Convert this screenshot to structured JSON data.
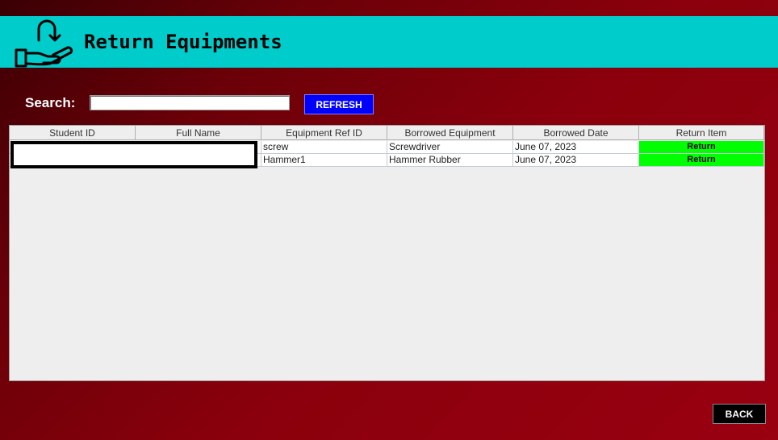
{
  "header": {
    "title": "Return Equipments",
    "icon": "hand-return-icon",
    "background": "#00cccc"
  },
  "search": {
    "label": "Search:",
    "value": "",
    "placeholder": ""
  },
  "buttons": {
    "refresh": "REFRESH",
    "back": "BACK",
    "refresh_color": "#0000ff",
    "back_color": "#000000"
  },
  "table": {
    "columns": [
      "Student ID",
      "Full Name",
      "Equipment Ref ID",
      "Borrowed Equipment",
      "Borrowed Date",
      "Return Item"
    ],
    "rows": [
      {
        "student_id": "",
        "full_name": "",
        "ref_id": "screw",
        "equipment": "Screwdriver",
        "date": "June 07, 2023",
        "action": "Return"
      },
      {
        "student_id": "",
        "full_name": "",
        "ref_id": "Hammer1",
        "equipment": "Hammer Rubber",
        "date": "June 07, 2023",
        "action": "Return"
      }
    ],
    "return_color": "#00ff00"
  }
}
